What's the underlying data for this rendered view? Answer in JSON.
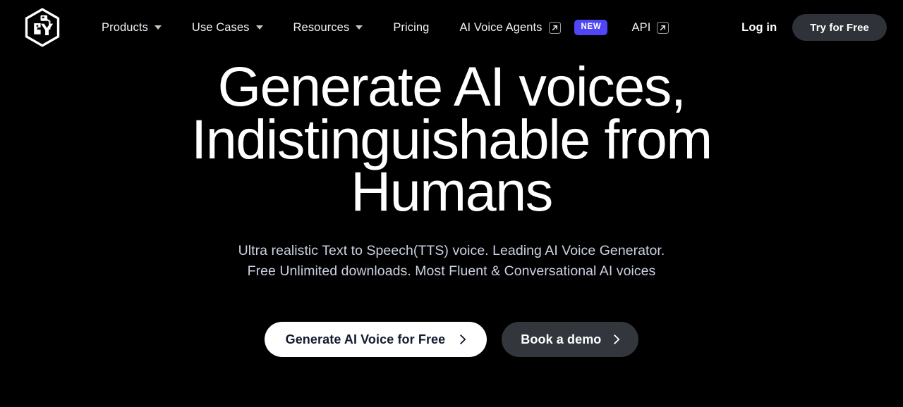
{
  "brand": {
    "logo_icon": "cube-hexagon-logo"
  },
  "nav": {
    "items": [
      {
        "label": "Products",
        "icon": "chevron-down-icon",
        "name": "products"
      },
      {
        "label": "Use Cases",
        "icon": "chevron-down-icon",
        "name": "use-cases"
      },
      {
        "label": "Resources",
        "icon": "chevron-down-icon",
        "name": "resources"
      },
      {
        "label": "Pricing",
        "icon": null,
        "name": "pricing"
      },
      {
        "label": "AI Voice Agents",
        "icon": "external-link-icon",
        "name": "ai-voice-agents",
        "badge": "NEW"
      },
      {
        "label": "API",
        "icon": "external-link-icon",
        "name": "api"
      }
    ],
    "login_label": "Log in",
    "cta_label": "Try for Free",
    "badge_color": "#4f46f5"
  },
  "hero": {
    "headline_line1": "Generate AI voices,",
    "headline_line2": "Indistinguishable from",
    "headline_line3": "Humans",
    "subhead_line1": "Ultra realistic Text to Speech(TTS) voice. Leading AI Voice Generator.",
    "subhead_line2": "Free Unlimited downloads. Most Fluent & Conversational AI voices",
    "primary_cta": "Generate AI Voice for Free",
    "secondary_cta": "Book a demo",
    "chevron_icon": "chevron-right-icon"
  },
  "theme": {
    "background": "#000000",
    "text_primary": "#ffffff",
    "text_muted": "#ccd2e2",
    "pill_dark": "#33363d",
    "pill_light": "#ffffff",
    "cta_text_dark": "#141a2e"
  }
}
